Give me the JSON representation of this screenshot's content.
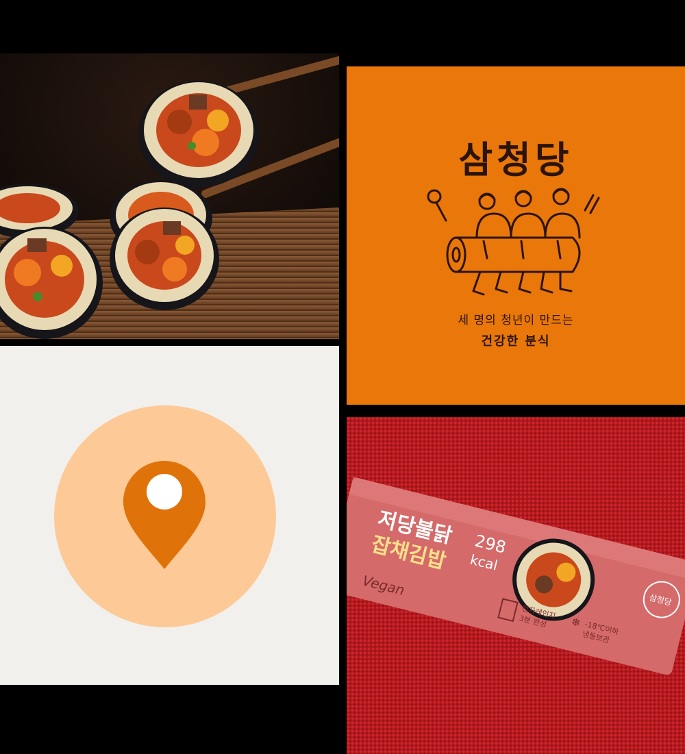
{
  "colors": {
    "background": "#000000",
    "logo_orange": "#e9770a",
    "logo_ink": "#2b1407",
    "map_background": "#f2f0ed",
    "map_circle": "#fdc996",
    "map_pin": "#e0720a",
    "carpet_red": "#c81b20",
    "package_pink": "#d46a6a"
  },
  "logo": {
    "title": "삼청당",
    "subtitle_line1": "세 명의 청년이 만드는",
    "subtitle_line2": "건강한 분식"
  },
  "map": {
    "icon": "location-pin-icon"
  },
  "package": {
    "name_line1": "저당불닭",
    "name_line2": "잡채김밥",
    "calories_value": "298",
    "calories_unit": "kcal",
    "vegan_label": "Vegan",
    "microwave_note_line1": "전자레인지",
    "microwave_note_line2": "3분 완성",
    "storage_temp": "-18℃이하",
    "storage_label": "냉동보관",
    "brand_badge": "삼청당"
  },
  "photo": {
    "subject": "kimbap-photo"
  }
}
